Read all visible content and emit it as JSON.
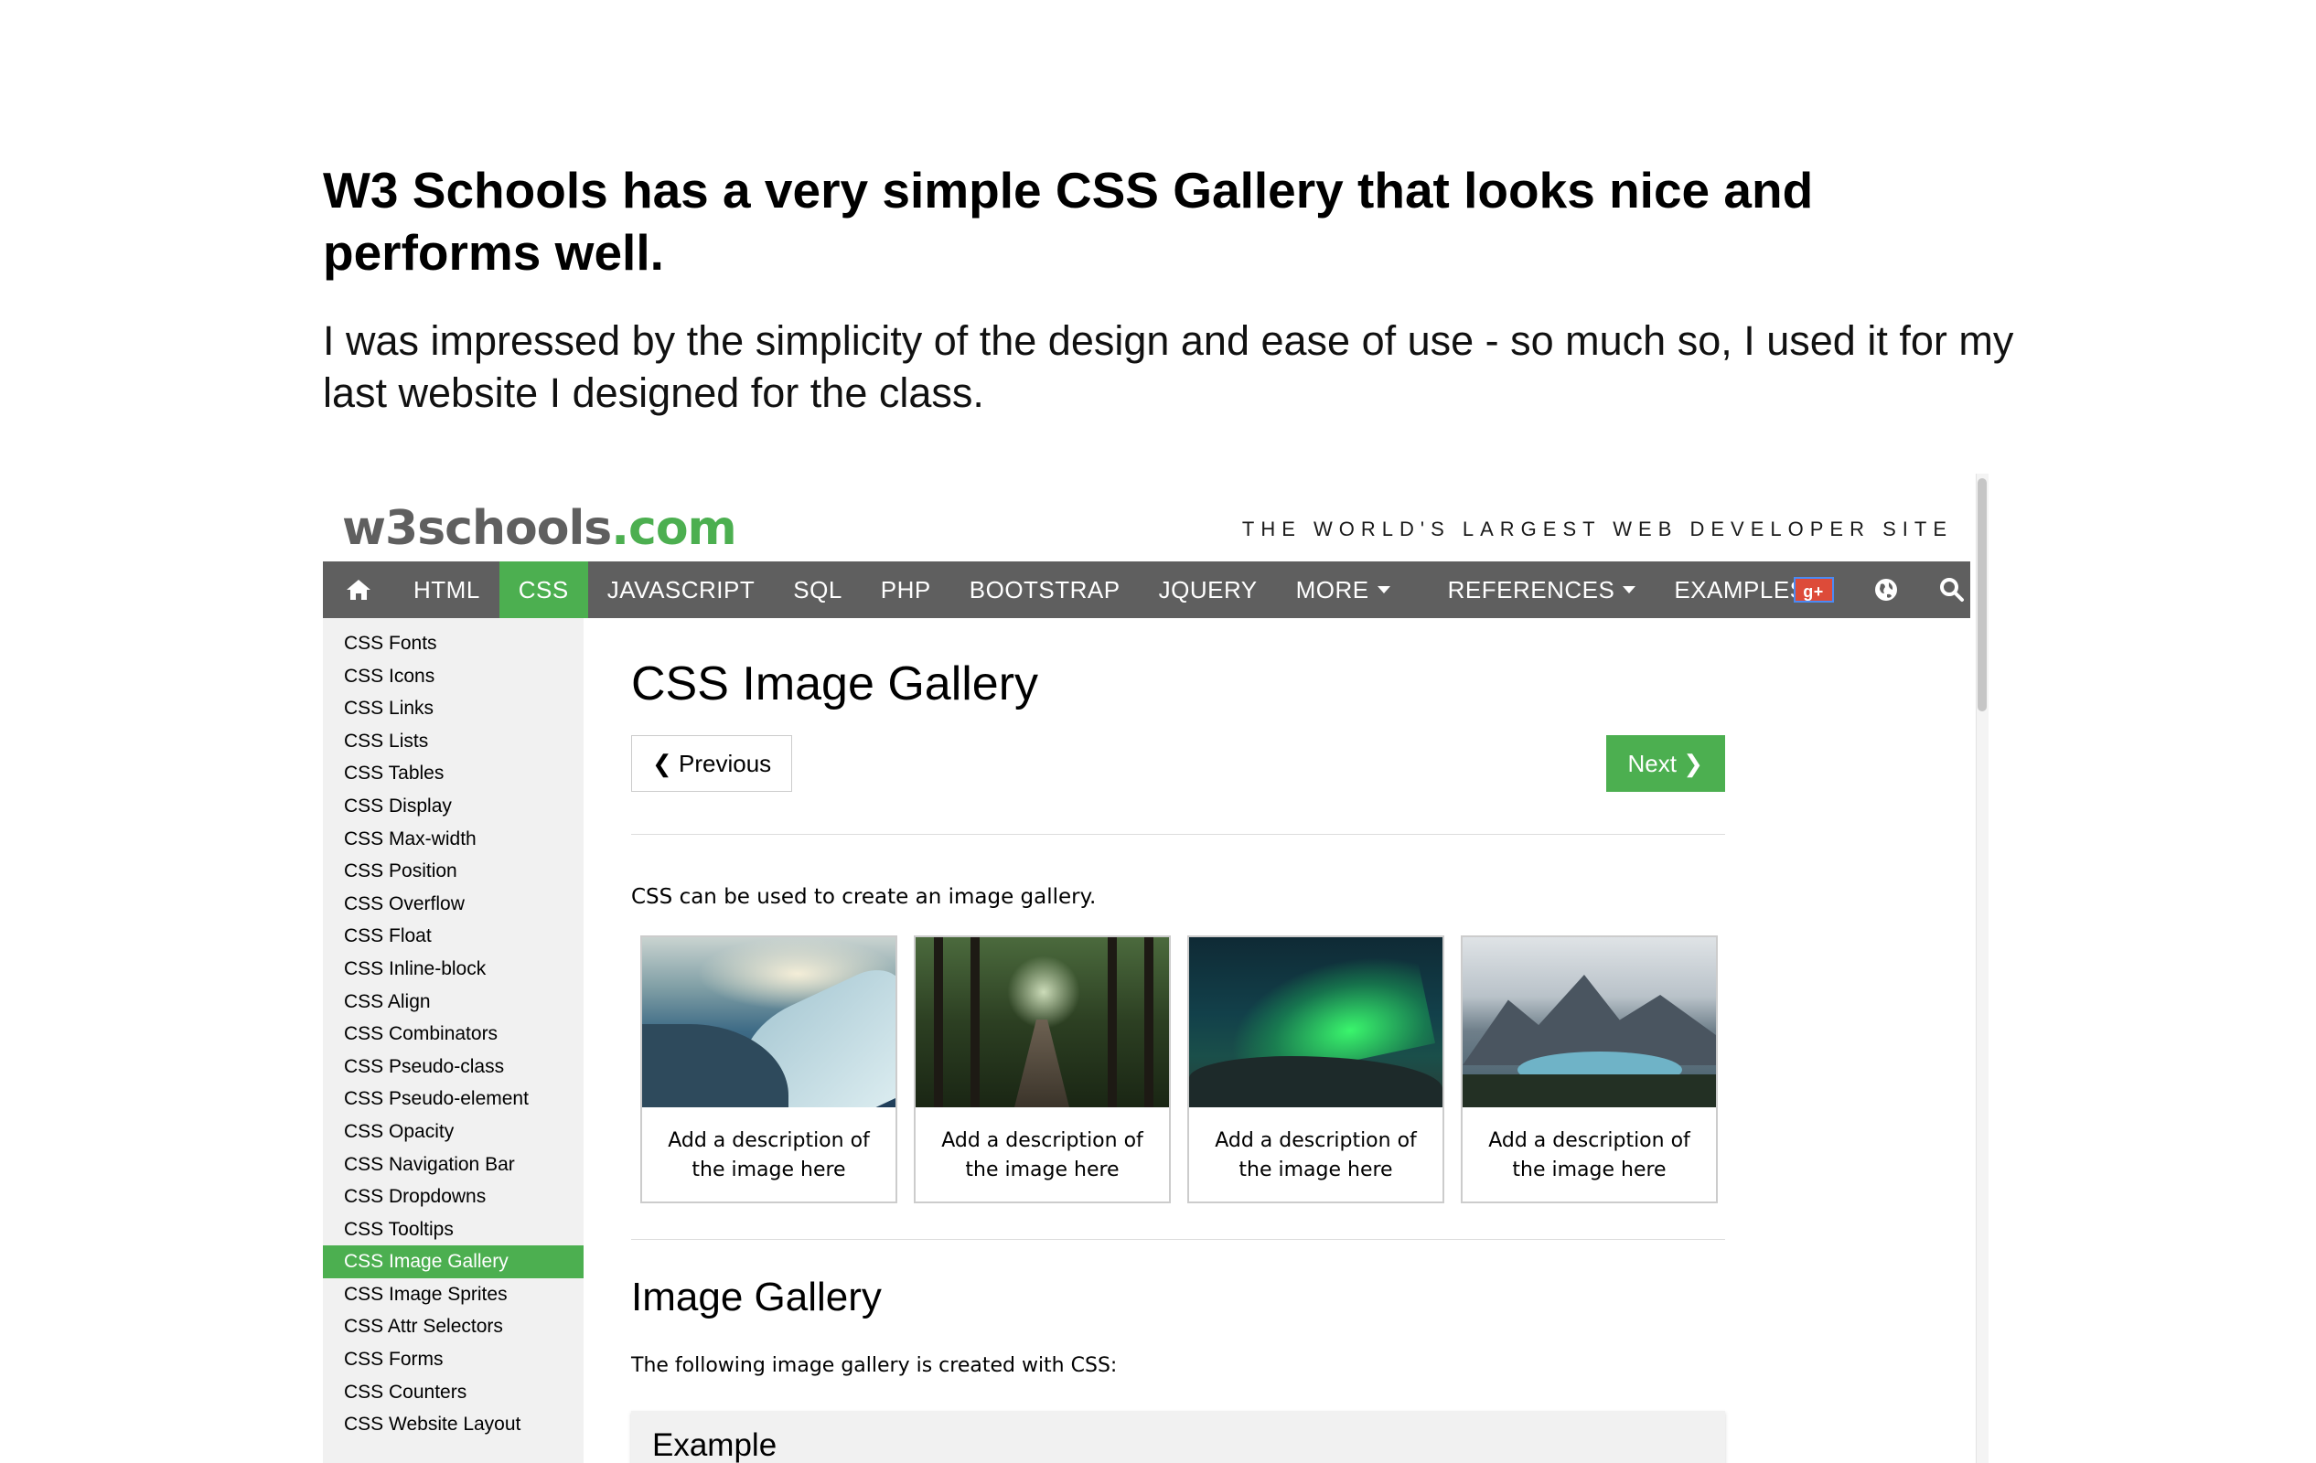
{
  "article": {
    "heading": "W3 Schools has a very simple CSS Gallery that looks nice and performs well.",
    "intro": "I was impressed by the simplicity of the design and ease of use - so much so, I used it for my last website I designed for the class."
  },
  "site": {
    "logo_main": "w3schools",
    "logo_suffix": ".com",
    "tagline": "THE WORLD'S LARGEST WEB DEVELOPER SITE",
    "accent_color": "#4CAF50",
    "nav_bg_color": "#5f5f5f"
  },
  "topnav": {
    "home_icon": "home-icon",
    "items": [
      {
        "label": "HTML",
        "active": false
      },
      {
        "label": "CSS",
        "active": true
      },
      {
        "label": "JAVASCRIPT",
        "active": false
      },
      {
        "label": "SQL",
        "active": false
      },
      {
        "label": "PHP",
        "active": false
      },
      {
        "label": "BOOTSTRAP",
        "active": false
      },
      {
        "label": "JQUERY",
        "active": false
      },
      {
        "label": "MORE",
        "active": false,
        "dropdown": true
      },
      {
        "label": "REFERENCES",
        "active": false,
        "dropdown": true
      },
      {
        "label": "EXAMPLES",
        "active": false
      }
    ],
    "gplus_badge": "g+",
    "globe_icon": "globe-icon",
    "search_icon": "search-icon"
  },
  "sidebar": {
    "items": [
      {
        "label": "CSS Fonts"
      },
      {
        "label": "CSS Icons"
      },
      {
        "label": "CSS Links"
      },
      {
        "label": "CSS Lists"
      },
      {
        "label": "CSS Tables"
      },
      {
        "label": "CSS Display"
      },
      {
        "label": "CSS Max-width"
      },
      {
        "label": "CSS Position"
      },
      {
        "label": "CSS Overflow"
      },
      {
        "label": "CSS Float"
      },
      {
        "label": "CSS Inline-block"
      },
      {
        "label": "CSS Align"
      },
      {
        "label": "CSS Combinators"
      },
      {
        "label": "CSS Pseudo-class"
      },
      {
        "label": "CSS Pseudo-element"
      },
      {
        "label": "CSS Opacity"
      },
      {
        "label": "CSS Navigation Bar"
      },
      {
        "label": "CSS Dropdowns"
      },
      {
        "label": "CSS Tooltips"
      },
      {
        "label": "CSS Image Gallery",
        "active": true
      },
      {
        "label": "CSS Image Sprites"
      },
      {
        "label": "CSS Attr Selectors"
      },
      {
        "label": "CSS Forms"
      },
      {
        "label": "CSS Counters"
      },
      {
        "label": "CSS Website Layout"
      }
    ]
  },
  "main": {
    "title": "CSS Image Gallery",
    "prev_label": "❮ Previous",
    "next_label": "Next ❯",
    "intro": "CSS can be used to create an image gallery.",
    "gallery": [
      {
        "desc": "Add a description of the image here"
      },
      {
        "desc": "Add a description of the image here"
      },
      {
        "desc": "Add a description of the image here"
      },
      {
        "desc": "Add a description of the image here"
      }
    ],
    "section_title": "Image Gallery",
    "section_text": "The following image gallery is created with CSS:",
    "example_title": "Example"
  }
}
